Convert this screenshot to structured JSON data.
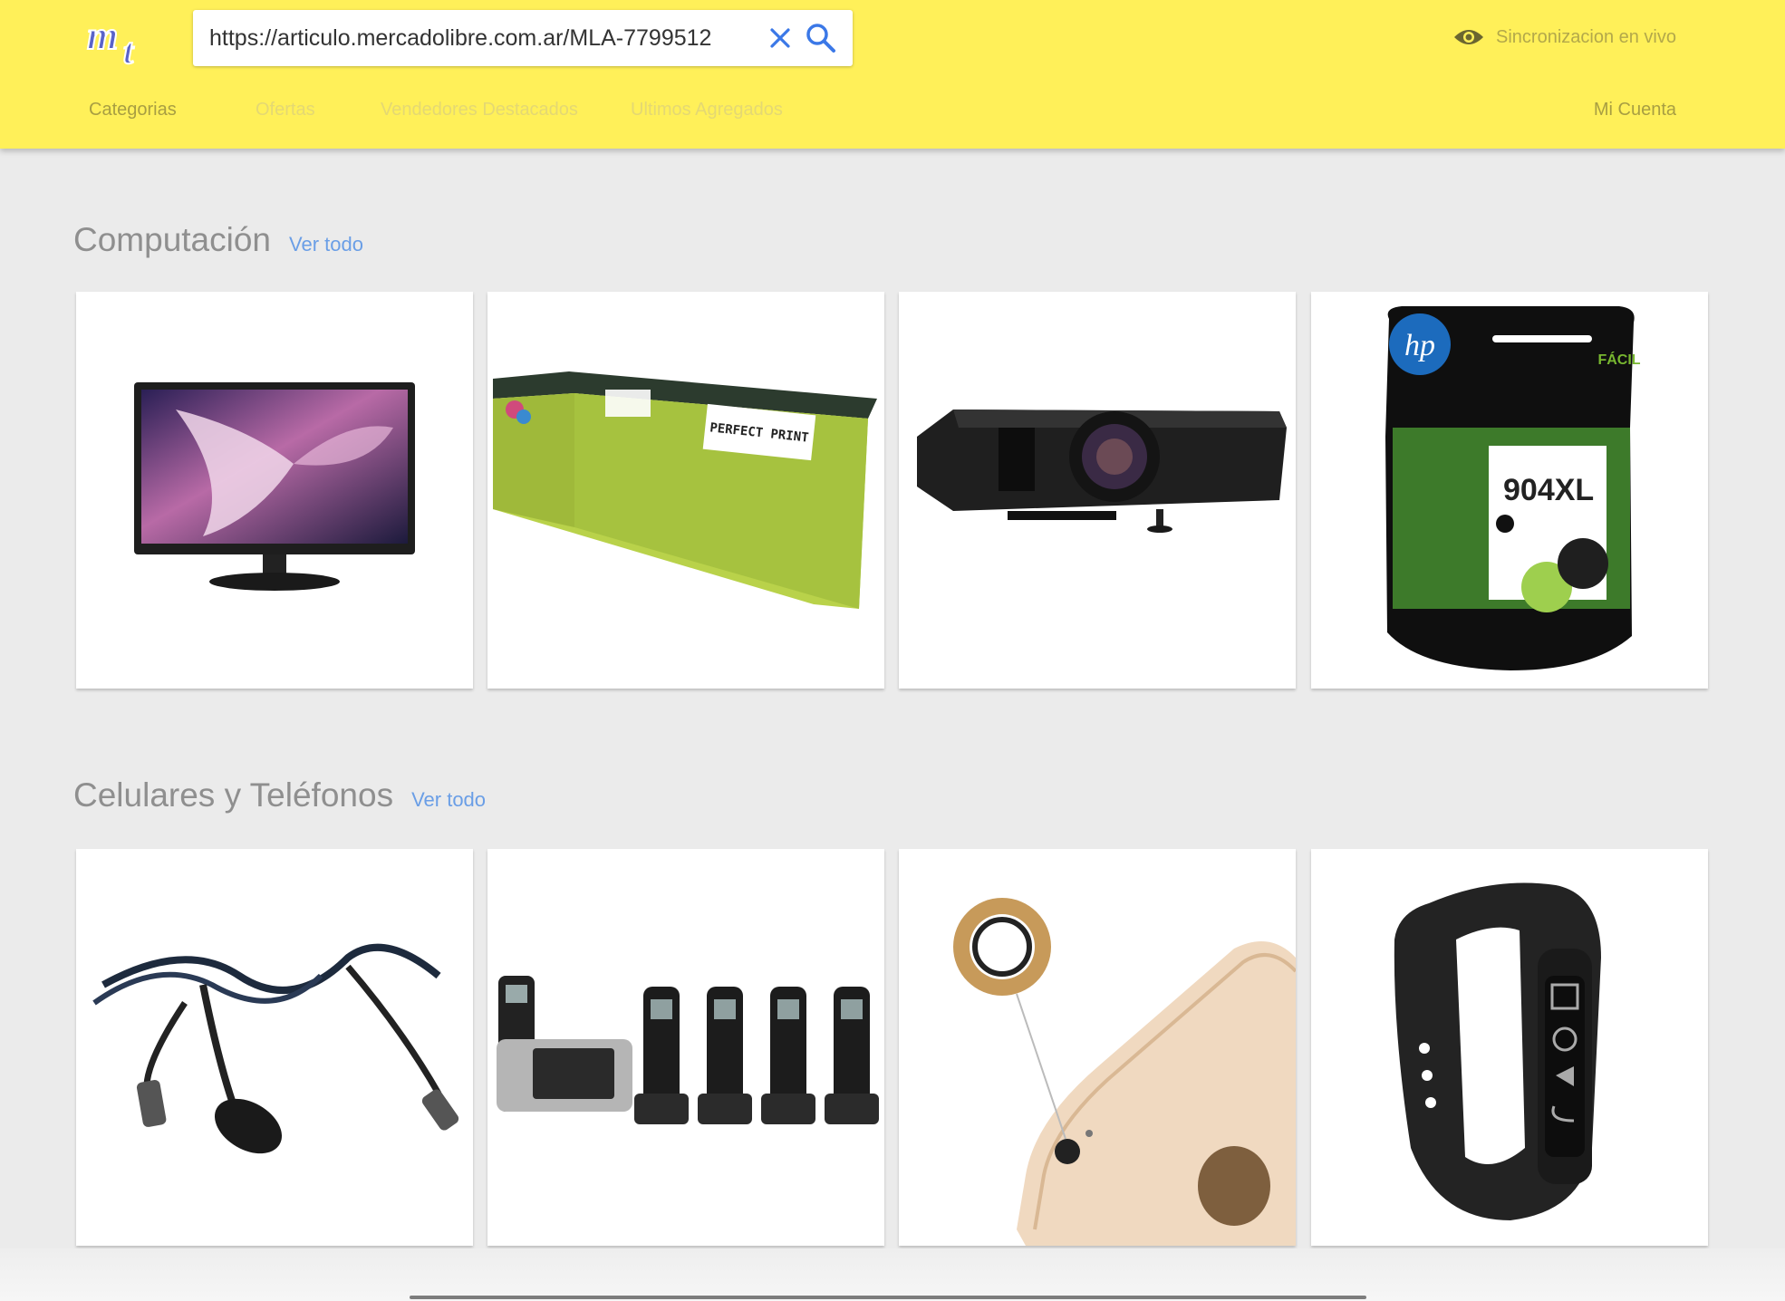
{
  "header": {
    "search": {
      "value": "https://articulo.mercadolibre.com.ar/MLA-7799512"
    },
    "sync_label": "Sincronizacion en vivo",
    "nav": [
      {
        "label": "Categorias"
      },
      {
        "label": "Ofertas"
      },
      {
        "label": "Vendedores Destacados"
      },
      {
        "label": "Ultimos Agregados"
      }
    ],
    "account_label": "Mi Cuenta"
  },
  "sections": [
    {
      "title": "Computación",
      "link": "Ver todo",
      "products": [
        {
          "image": "monitor"
        },
        {
          "image": "toner-box",
          "box_text": "PERFECT PRINT"
        },
        {
          "image": "projector"
        },
        {
          "image": "hp-ink-cartridge",
          "brand": "hp",
          "model": "904XL",
          "badge": "FÁCIL"
        }
      ]
    },
    {
      "title": "Celulares y Teléfonos",
      "link": "Ver todo",
      "products": [
        {
          "image": "cable"
        },
        {
          "image": "cordless-phones"
        },
        {
          "image": "camera-lens-protector"
        },
        {
          "image": "smart-band"
        }
      ]
    }
  ],
  "colors": {
    "header_bg": "#fff059",
    "link": "#6a9ee6",
    "title": "#8f8f8f",
    "page_bg": "#ebebeb"
  }
}
